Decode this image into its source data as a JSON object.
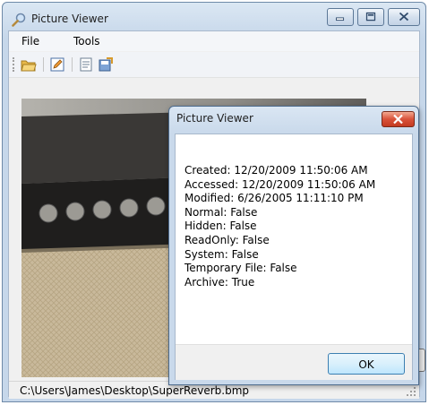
{
  "window": {
    "title": "Picture Viewer",
    "icon": "magnifier-icon"
  },
  "menu": {
    "items": [
      "File",
      "Tools"
    ]
  },
  "toolbar": {
    "buttons": [
      "open-folder-icon",
      "edit-icon",
      "properties-icon",
      "save-icon"
    ]
  },
  "status": {
    "path": "C:\\Users\\James\\Desktop\\SuperReverb.bmp"
  },
  "dialog": {
    "title": "Picture Viewer",
    "lines": [
      "Created: 12/20/2009 11:50:06 AM",
      "Accessed: 12/20/2009 11:50:06 AM",
      "Modified: 6/26/2005 11:11:10 PM",
      "Normal: False",
      "Hidden: False",
      "ReadOnly: False",
      "System: False",
      "Temporary File: False",
      "Archive: True"
    ],
    "ok_label": "OK"
  },
  "colors": {
    "title_bar": "#c6d7ea",
    "close_button": "#d9523a",
    "ok_border": "#3c7fb1"
  }
}
